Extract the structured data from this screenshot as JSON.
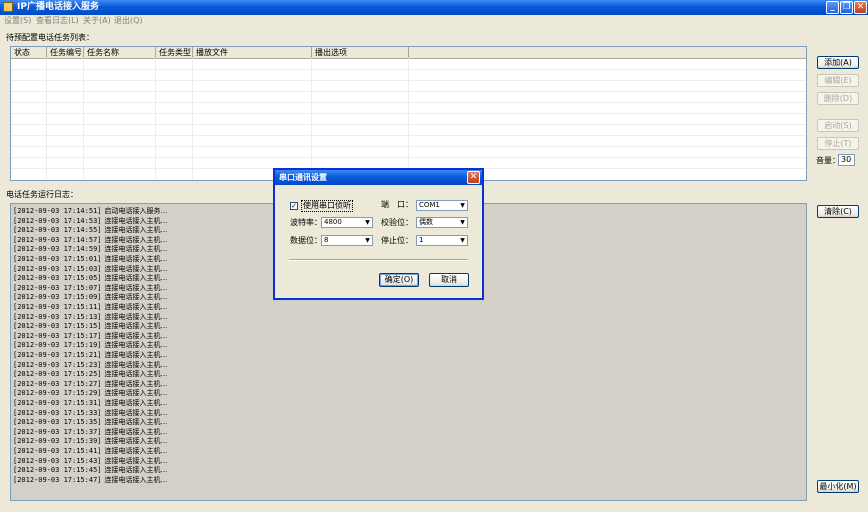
{
  "window": {
    "title": "IP广播电话接入服务",
    "controls": {
      "minimize": "_",
      "restore": "❐",
      "close": "✕"
    }
  },
  "menu": [
    "设置(S)",
    "查看日志(L)",
    "关于(A)",
    "退出(Q)"
  ],
  "task_list": {
    "label": "待预配置电话任务列表：",
    "columns": [
      "状态",
      "任务编号",
      "任务名称",
      "任务类型",
      "播放文件",
      "播出选项"
    ]
  },
  "side_buttons": {
    "add": "添加(A)",
    "edit": "编辑(E)",
    "delete": "删除(D)",
    "start": "启动(S)",
    "stop": "停止(T)",
    "clear": "清除(C)",
    "minimize": "最小化(M)"
  },
  "volume": {
    "label": "音量：",
    "value": "30"
  },
  "log": {
    "label": "电话任务运行日志：",
    "lines": [
      {
        "ts": "[2012-09-03 17:14:51]",
        "msg": "启动电话接入服务..."
      },
      {
        "ts": "[2012-09-03 17:14:53]",
        "msg": "连接电话接入主机..."
      },
      {
        "ts": "[2012-09-03 17:14:55]",
        "msg": "连接电话接入主机..."
      },
      {
        "ts": "[2012-09-03 17:14:57]",
        "msg": "连接电话接入主机..."
      },
      {
        "ts": "[2012-09-03 17:14:59]",
        "msg": "连接电话接入主机..."
      },
      {
        "ts": "[2012-09-03 17:15:01]",
        "msg": "连接电话接入主机..."
      },
      {
        "ts": "[2012-09-03 17:15:03]",
        "msg": "连接电话接入主机..."
      },
      {
        "ts": "[2012-09-03 17:15:05]",
        "msg": "连接电话接入主机..."
      },
      {
        "ts": "[2012-09-03 17:15:07]",
        "msg": "连接电话接入主机..."
      },
      {
        "ts": "[2012-09-03 17:15:09]",
        "msg": "连接电话接入主机..."
      },
      {
        "ts": "[2012-09-03 17:15:11]",
        "msg": "连接电话接入主机..."
      },
      {
        "ts": "[2012-09-03 17:15:13]",
        "msg": "连接电话接入主机..."
      },
      {
        "ts": "[2012-09-03 17:15:15]",
        "msg": "连接电话接入主机..."
      },
      {
        "ts": "[2012-09-03 17:15:17]",
        "msg": "连接电话接入主机..."
      },
      {
        "ts": "[2012-09-03 17:15:19]",
        "msg": "连接电话接入主机..."
      },
      {
        "ts": "[2012-09-03 17:15:21]",
        "msg": "连接电话接入主机..."
      },
      {
        "ts": "[2012-09-03 17:15:23]",
        "msg": "连接电话接入主机..."
      },
      {
        "ts": "[2012-09-03 17:15:25]",
        "msg": "连接电话接入主机..."
      },
      {
        "ts": "[2012-09-03 17:15:27]",
        "msg": "连接电话接入主机..."
      },
      {
        "ts": "[2012-09-03 17:15:29]",
        "msg": "连接电话接入主机..."
      },
      {
        "ts": "[2012-09-03 17:15:31]",
        "msg": "连接电话接入主机..."
      },
      {
        "ts": "[2012-09-03 17:15:33]",
        "msg": "连接电话接入主机..."
      },
      {
        "ts": "[2012-09-03 17:15:35]",
        "msg": "连接电话接入主机..."
      },
      {
        "ts": "[2012-09-03 17:15:37]",
        "msg": "连接电话接入主机..."
      },
      {
        "ts": "[2012-09-03 17:15:39]",
        "msg": "连接电话接入主机..."
      },
      {
        "ts": "[2012-09-03 17:15:41]",
        "msg": "连接电话接入主机..."
      },
      {
        "ts": "[2012-09-03 17:15:43]",
        "msg": "连接电话接入主机..."
      },
      {
        "ts": "[2012-09-03 17:15:45]",
        "msg": "连接电话接入主机..."
      },
      {
        "ts": "[2012-09-03 17:15:47]",
        "msg": "连接电话接入主机..."
      }
    ]
  },
  "dialog": {
    "title": "串口通讯设置",
    "enable_label": "使用串口侦听",
    "enable_checked": true,
    "port_label": "端　口：",
    "port_value": "COM1",
    "baud_label": "波特率：",
    "baud_value": "4800",
    "parity_label": "校验位：",
    "parity_value": "偶数",
    "databits_label": "数据位：",
    "databits_value": "8",
    "stopbits_label": "停止位：",
    "stopbits_value": "1",
    "ok": "确定(O)",
    "cancel": "取消"
  }
}
